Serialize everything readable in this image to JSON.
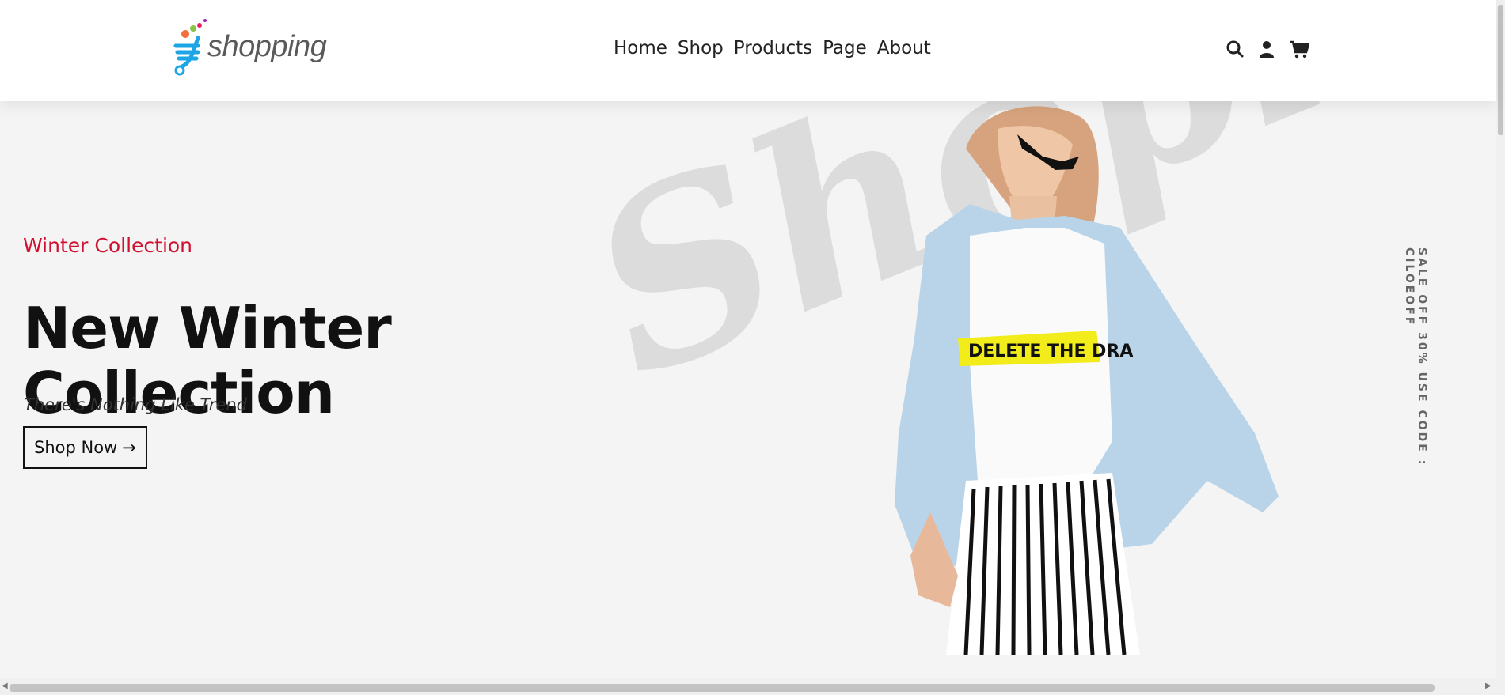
{
  "header": {
    "logo_text": "shopping",
    "nav": [
      "Home",
      "Shop",
      "Products",
      "Page",
      "About"
    ],
    "icons": [
      "search-icon",
      "user-icon",
      "cart-icon"
    ]
  },
  "hero": {
    "eyebrow": "Winter Collection",
    "title": "New Winter Collection",
    "subtitle": "There's Nothing Like Trend",
    "cta_label": "Shop Now",
    "watermark": "Shopis",
    "side_text": "SALE OFF 30% USE CODE : CILOEOFF",
    "tshirt_text": "DELETE THE DRA",
    "colors": {
      "accent": "#d0102f",
      "text": "#111111",
      "background": "#f4f4f4"
    }
  }
}
